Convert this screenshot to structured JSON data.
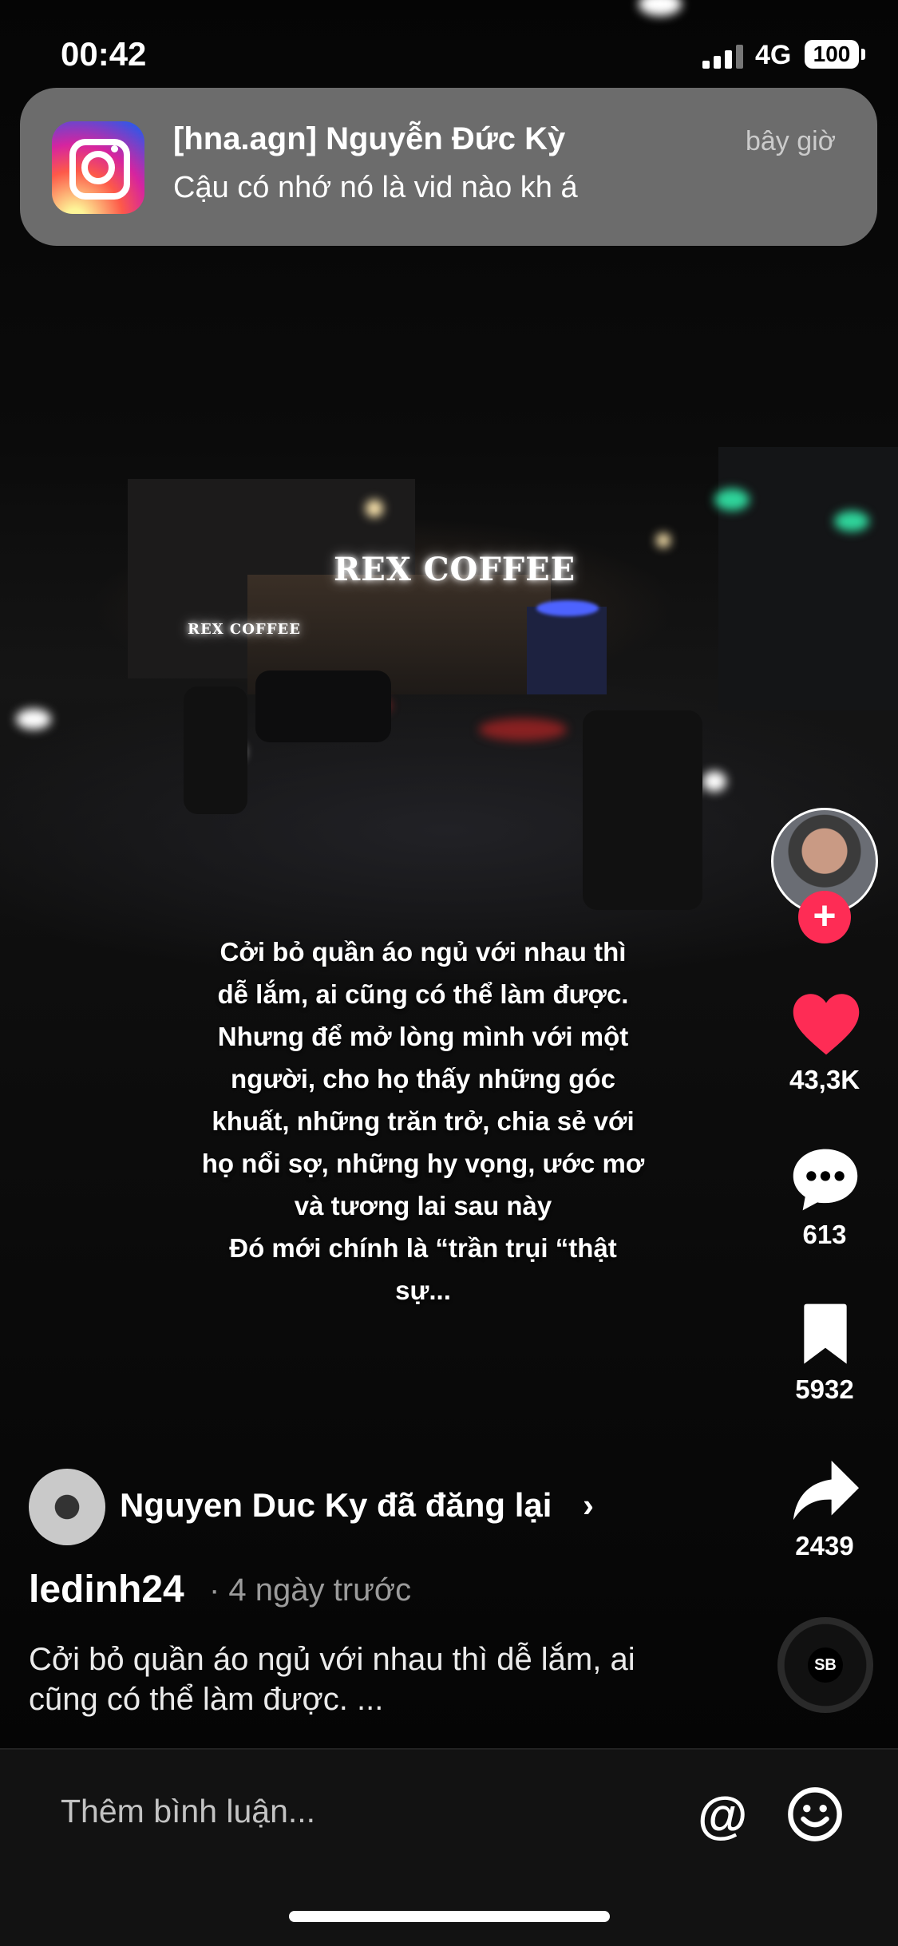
{
  "status_bar": {
    "time": "00:42",
    "network": "4G",
    "battery": "100"
  },
  "notification": {
    "app_icon": "instagram-icon",
    "title": "[hna.agn] Nguyễn Đức Kỳ",
    "time": "bây giờ",
    "body": "Cậu có nhớ nó là vid nào kh á"
  },
  "video": {
    "sign_text": "REX COFFEE",
    "sign_small": "REX COFFEE",
    "overlay_lines": [
      "Cởi bỏ quần áo ngủ với nhau thì",
      "dễ lắm, ai cũng có thể làm được.",
      "Nhưng để mở lòng mình với một",
      "người, cho họ thấy những góc",
      "khuất, những trăn trở, chia sẻ với",
      "họ nổi sợ, những hy vọng, ước mơ",
      "và tương lai sau này",
      "Đó mới chính là “trần trụi “thật",
      "sự..."
    ]
  },
  "actions": {
    "likes": "43,3K",
    "comments": "613",
    "saves": "5932",
    "shares": "2439"
  },
  "post": {
    "repost_text": "Nguyen Duc Ky đã đăng lại",
    "repost_chevron": "›",
    "username": "ledinh24",
    "date": "· 4 ngày trước",
    "caption": "Cởi bỏ quần áo ngủ với nhau thì dễ lắm, ai cũng có thể làm được.  ..."
  },
  "comment_bar": {
    "placeholder": "Thêm bình luận...",
    "at_symbol": "@"
  },
  "colors": {
    "like_red": "#fe2c55",
    "background": "#000000",
    "comment_bar": "#121212"
  }
}
